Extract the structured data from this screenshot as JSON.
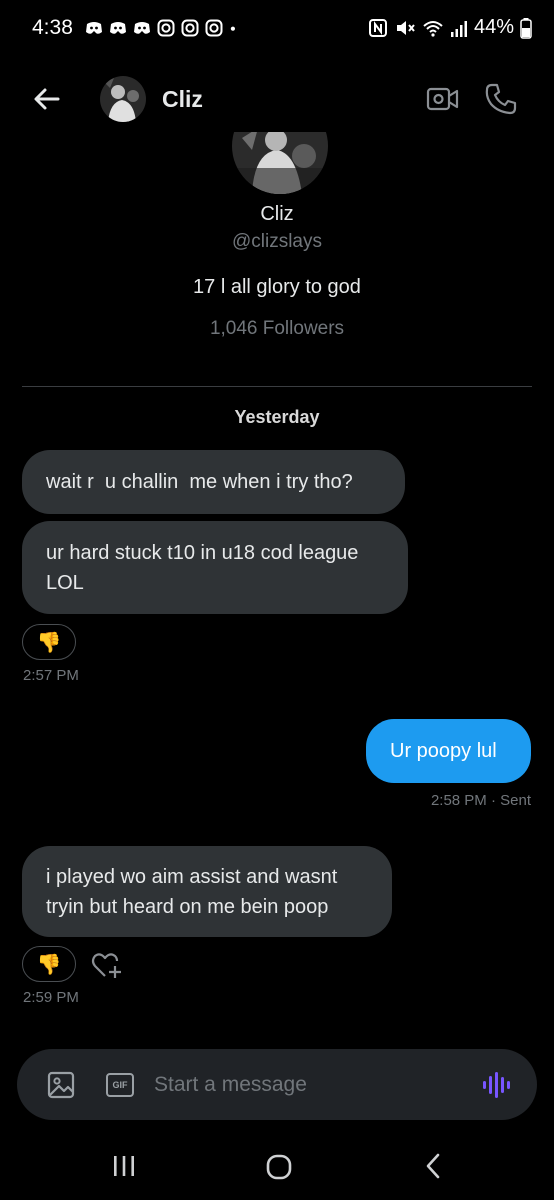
{
  "status_bar": {
    "time": "4:38",
    "battery": "44%",
    "left_icons": [
      "discord-icon",
      "discord-icon",
      "discord-icon",
      "instagram-icon",
      "instagram-icon",
      "instagram-icon",
      "dot-icon"
    ],
    "right_icons": [
      "nfc-icon",
      "mute-icon",
      "wifi-icon",
      "signal-icon",
      "battery-icon"
    ]
  },
  "header": {
    "name": "Cliz",
    "icons": [
      "back-arrow-icon",
      "video-call-icon",
      "phone-icon"
    ]
  },
  "profile": {
    "name": "Cliz",
    "handle": "@clizslays",
    "bio": "17 l all glory to god",
    "followers": "1,046 Followers"
  },
  "conversation": {
    "day_label": "Yesterday",
    "messages": [
      {
        "direction": "in",
        "text": "wait r  u challin  me when i try tho?"
      },
      {
        "direction": "in",
        "text": "ur hard stuck t10 in u18 cod league LOL",
        "reaction": "👎",
        "timestamp": "2:57 PM"
      },
      {
        "direction": "out",
        "text": "Ur poopy lul",
        "timestamp": "2:58 PM · Sent"
      },
      {
        "direction": "in",
        "text": "i played wo aim assist and wasnt tryin but heard on me bein poop",
        "reaction": "👎",
        "timestamp": "2:59 PM"
      }
    ]
  },
  "composer": {
    "placeholder": "Start a message",
    "gif_label": "GIF"
  },
  "colors": {
    "background": "#000000",
    "incoming_bubble": "#2f3336",
    "outgoing_bubble": "#1d9bf0",
    "muted_text": "#71767b",
    "voice_accent": "#7856ff"
  }
}
